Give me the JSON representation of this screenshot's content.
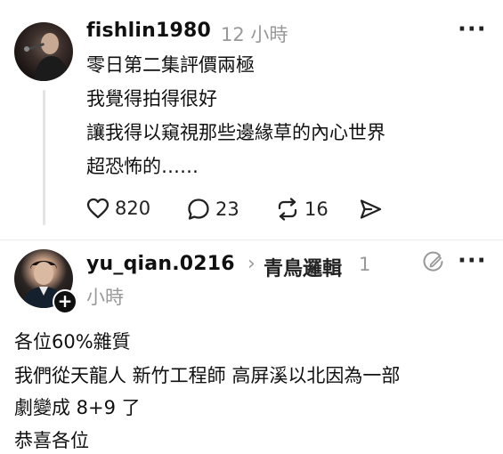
{
  "post1": {
    "username": "fishlin1980",
    "time": "12 小時",
    "lines": [
      "零日第二集評價兩極",
      "我覺得拍得很好",
      "讓我得以窺視那些邊緣草的內心世界",
      "超恐怖的……"
    ],
    "likes": "820",
    "comments": "23",
    "reposts": "16"
  },
  "post2": {
    "username": "yu_qian.0216",
    "topic": "青鳥邏輯",
    "time_a": "1",
    "time_b": "小時",
    "lines": [
      "各位60%雜質",
      "我們從天龍人 新竹工程師 高屏溪以北因為一部",
      "劇變成 8+9 了",
      "恭喜各位"
    ],
    "add_badge": "+"
  }
}
